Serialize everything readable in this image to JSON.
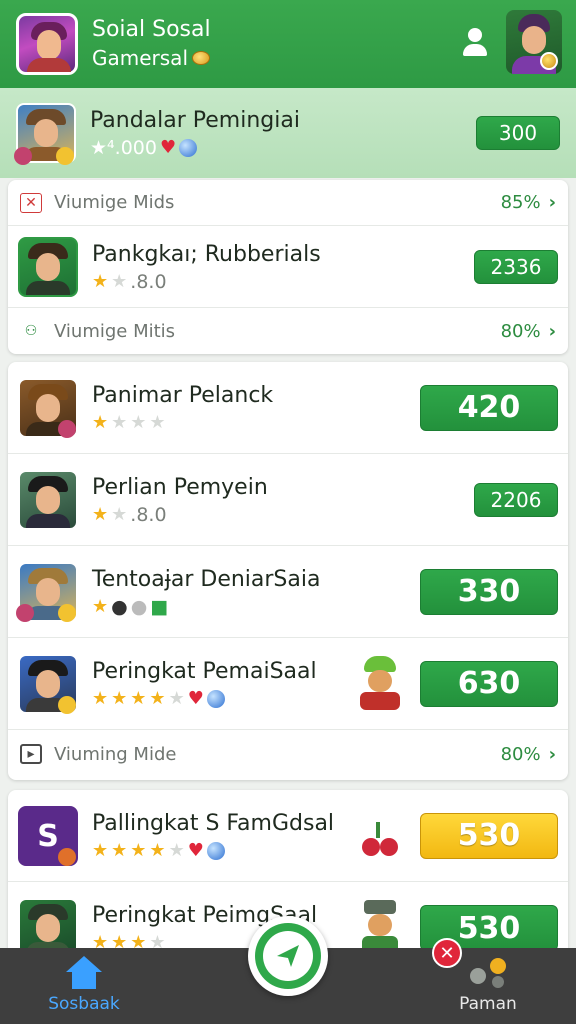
{
  "header": {
    "title_line1": "Soial Sosal",
    "title_line2": "Gamersal",
    "icons": [
      "avatar-left",
      "coin-icon",
      "user-icon",
      "avatar-right"
    ]
  },
  "featured": {
    "name": "Pandalar Pemingiai",
    "sub": "★⁴.000",
    "score": "300"
  },
  "card1": {
    "section1": {
      "label": "Viumige Mids",
      "pct": "85%",
      "icon": "close-icon"
    },
    "row": {
      "name": "Pankgkaı; Rubberials",
      "sub": ".8.0",
      "score": "2336"
    },
    "section2": {
      "label": "Viumige Mitis",
      "pct": "80%",
      "icon": "group-icon"
    }
  },
  "card2": {
    "rows": [
      {
        "name": "Panimar Pelanck",
        "sub": "",
        "score": "420"
      },
      {
        "name": "Perlian Pemyein",
        "sub": ".8.0",
        "score": "2206"
      },
      {
        "name": "Tentoaɉar DeniarSaia",
        "sub": "",
        "score": "330"
      },
      {
        "name": "Peringkat PemaiSaal",
        "sub": "",
        "score": "630"
      }
    ],
    "section": {
      "label": "Viuming Mide",
      "pct": "80%",
      "icon": "play-icon"
    }
  },
  "card3": {
    "rows": [
      {
        "name": "Pallingkat S FamGdsal",
        "sub": "",
        "score": "530"
      },
      {
        "name": "Peringkat PeimgSaal",
        "sub": "",
        "score": "530"
      }
    ]
  },
  "nav": {
    "left_label": "Sosbaak",
    "right_label": "Paman",
    "x_badge": "✕"
  },
  "colors": {
    "header_green": "#2e9a44",
    "button_green": "#2fa84a",
    "button_gold": "#f2b812",
    "nav_dark": "#3e3e3e",
    "nav_blue": "#4aa8ff",
    "accent_red": "#e0263a"
  }
}
